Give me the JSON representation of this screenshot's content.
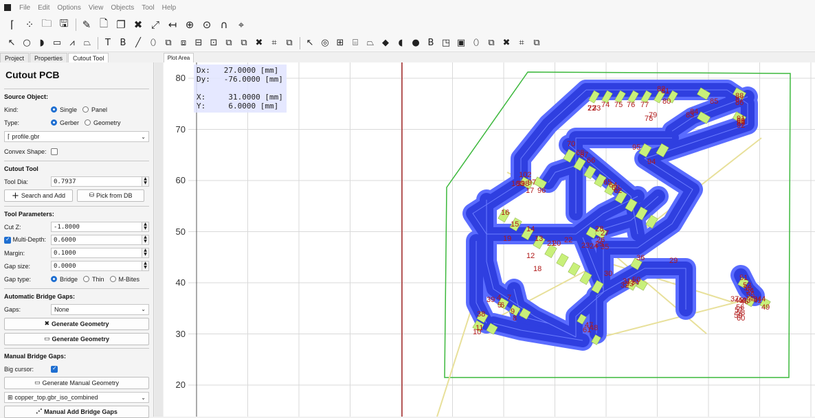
{
  "menu": [
    "File",
    "Edit",
    "Options",
    "View",
    "Objects",
    "Tool",
    "Help"
  ],
  "toolbar1": [
    {
      "icon": "open-gerber-icon",
      "glyph": "⌈"
    },
    {
      "icon": "excellon-icon",
      "glyph": "⁘"
    },
    {
      "icon": "folder-icon",
      "glyph": "🗀"
    },
    {
      "icon": "save-icon",
      "glyph": "🖫"
    },
    {
      "sep": true
    },
    {
      "icon": "pencil-icon",
      "glyph": "✎"
    },
    {
      "icon": "document-new-icon",
      "glyph": "🗋"
    },
    {
      "icon": "copy-icon",
      "glyph": "❐"
    },
    {
      "icon": "delete-icon",
      "glyph": "✖"
    },
    {
      "icon": "resize-icon",
      "glyph": "⤢"
    },
    {
      "icon": "distance-icon",
      "glyph": "↤"
    },
    {
      "icon": "crosshair-icon",
      "glyph": "⊕"
    },
    {
      "icon": "target-icon",
      "glyph": "⊙"
    },
    {
      "icon": "magnet-icon",
      "glyph": "∩"
    },
    {
      "icon": "map-pin-icon",
      "glyph": "⌖"
    }
  ],
  "toolbar2": [
    {
      "icon": "pointer-icon",
      "glyph": "↖"
    },
    {
      "icon": "circle-icon",
      "glyph": "○"
    },
    {
      "icon": "arc-icon",
      "glyph": "◗"
    },
    {
      "icon": "rectangle-icon",
      "glyph": "▭"
    },
    {
      "icon": "path-icon",
      "glyph": "⩘"
    },
    {
      "icon": "polygon-icon",
      "glyph": "⏢"
    },
    {
      "sep": true
    },
    {
      "icon": "text-icon",
      "glyph": "T"
    },
    {
      "icon": "bold-icon",
      "glyph": "B"
    },
    {
      "icon": "line-icon",
      "glyph": "╱"
    },
    {
      "icon": "paint-icon",
      "glyph": "⬯"
    },
    {
      "icon": "union-icon",
      "glyph": "⧉"
    },
    {
      "icon": "intersect-icon",
      "glyph": "⧈"
    },
    {
      "icon": "subtract-icon",
      "glyph": "⊟"
    },
    {
      "icon": "cut-icon",
      "glyph": "⊡"
    },
    {
      "icon": "copy-shape-icon",
      "glyph": "⧉"
    },
    {
      "icon": "move-icon",
      "glyph": "⧉"
    },
    {
      "icon": "delete-shape-icon",
      "glyph": "✖"
    },
    {
      "icon": "transform-icon",
      "glyph": "⌗"
    },
    {
      "icon": "move-shape-icon",
      "glyph": "⧉"
    },
    {
      "sep": true
    },
    {
      "icon": "select-icon",
      "glyph": "↖"
    },
    {
      "icon": "pad-icon",
      "glyph": "◎"
    },
    {
      "icon": "pad-array-icon",
      "glyph": "⊞"
    },
    {
      "icon": "track-icon",
      "glyph": "⌸"
    },
    {
      "icon": "region-icon",
      "glyph": "⏢"
    },
    {
      "icon": "poly-icon",
      "glyph": "◆"
    },
    {
      "icon": "semidisc-icon",
      "glyph": "◖"
    },
    {
      "icon": "disc-icon",
      "glyph": "●"
    },
    {
      "icon": "buffer-icon",
      "glyph": "B"
    },
    {
      "icon": "scale-icon",
      "glyph": "◳"
    },
    {
      "icon": "mark-area-icon",
      "glyph": "▣"
    },
    {
      "icon": "eraser-icon",
      "glyph": "⬯"
    },
    {
      "icon": "copy-pad-icon",
      "glyph": "⧉"
    },
    {
      "icon": "delete-pad-icon",
      "glyph": "✖"
    },
    {
      "icon": "transform-pad-icon",
      "glyph": "⌗"
    },
    {
      "icon": "move-pad-icon",
      "glyph": "⧉"
    }
  ],
  "tabs": {
    "project": "Project",
    "properties": "Properties",
    "cutout": "Cutout Tool",
    "plot": "Plot Area"
  },
  "panel": {
    "title": "Cutout PCB",
    "source_object": "Source Object:",
    "kind_label": "Kind:",
    "kind_single": "Single",
    "kind_panel": "Panel",
    "type_label": "Type:",
    "type_gerber": "Gerber",
    "type_geometry": "Geometry",
    "object_value": "profile.gbr",
    "convex_label": "Convex Shape:",
    "cutout_tool": "Cutout Tool",
    "tool_dia_label": "Tool Dia:",
    "tool_dia_value": "0.7937",
    "search_add": "Search and Add",
    "pick_db": "Pick from DB",
    "tool_params": "Tool Parameters:",
    "cutz_label": "Cut Z:",
    "cutz_value": "-1.8000",
    "multidepth_label": "Multi-Depth:",
    "multidepth_value": "0.6000",
    "margin_label": "Margin:",
    "margin_value": "0.1000",
    "gapsize_label": "Gap size:",
    "gapsize_value": "0.0000",
    "gaptype_label": "Gap type:",
    "gap_bridge": "Bridge",
    "gap_thin": "Thin",
    "gap_mbites": "M-Bites",
    "auto_bridge": "Automatic Bridge Gaps:",
    "gaps_label": "Gaps:",
    "gaps_value": "None",
    "gen_geom1": "Generate Geometry",
    "gen_geom2": "Generate Geometry",
    "manual_bridge": "Manual Bridge Gaps:",
    "big_cursor_label": "Big cursor:",
    "gen_manual": "Generate Manual Geometry",
    "manual_object": "copper_top.gbr_iso_combined",
    "manual_add": "Manual Add Bridge Gaps"
  },
  "plot": {
    "dx": "Dx:   27.0000 [mm]",
    "dy": "Dy:   -76.0000 [mm]",
    "x": "X:     31.0000 [mm]",
    "y": "Y:     6.0000 [mm]",
    "yticks": [
      "80",
      "70",
      "60",
      "50",
      "40",
      "30",
      "20"
    ],
    "labels": [
      "72",
      "73",
      "74",
      "75",
      "76",
      "77",
      "78",
      "79",
      "80",
      "81",
      "82",
      "83",
      "84",
      "85",
      "86",
      "87",
      "88",
      "89",
      "90",
      "91",
      "92",
      "93",
      "70",
      "68",
      "67",
      "66",
      "65",
      "64",
      "63",
      "62",
      "95",
      "94",
      "102",
      "100",
      "99",
      "98",
      "97",
      "96",
      "17",
      "16",
      "15",
      "14",
      "13",
      "12",
      "18",
      "19",
      "20",
      "21",
      "22",
      "23",
      "24",
      "25",
      "26",
      "27",
      "28",
      "35",
      "36",
      "29",
      "30",
      "31",
      "32",
      "33",
      "34",
      "50",
      "51",
      "52",
      "53",
      "54",
      "55",
      "56",
      "57",
      "58",
      "59",
      "60",
      "61",
      "47",
      "48",
      "49",
      "40",
      "41",
      "42",
      "43",
      "44",
      "45",
      "46",
      "37",
      "38",
      "39",
      "4",
      "5",
      "6",
      "7",
      "8",
      "9",
      "10",
      "11",
      "2",
      "3"
    ],
    "colors": {
      "trace": "#2f3fe0",
      "trace_edge": "#5a6cff",
      "pad": "#c8f07a",
      "label": "#b01818",
      "outline": "#3cb83c",
      "ratsnest": "#e8e09a",
      "axis": "#a52a2a",
      "grid": "#d9d9d9"
    }
  }
}
